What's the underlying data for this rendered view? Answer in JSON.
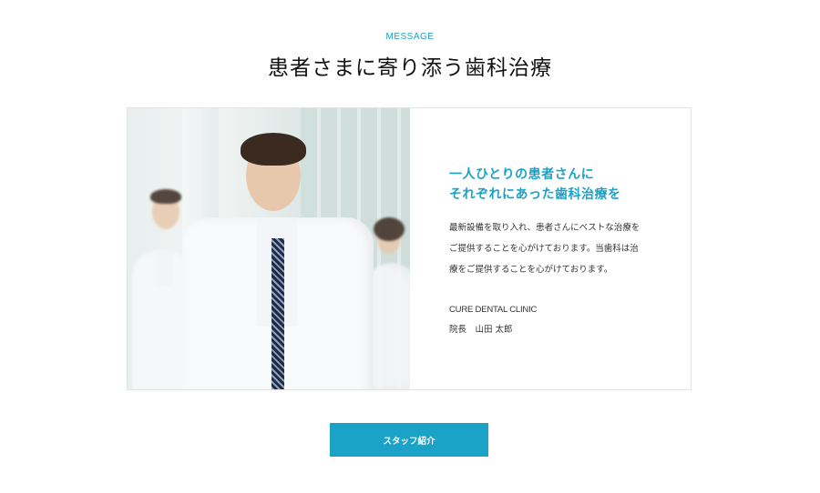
{
  "section": {
    "eyebrow": "MESSAGE",
    "title": "患者さまに寄り添う歯科治療"
  },
  "message": {
    "headline_lines": [
      "一人ひとりの患者さんに",
      "それぞれにあった歯科治療を"
    ],
    "body_lines": [
      "最新設備を取り入れ、患者さんにベストな治療を",
      "ご提供することを心がけております。当歯科は治",
      "療をご提供することを心がけております。"
    ],
    "clinic_name": "CURE DENTAL CLINIC",
    "director": "院長　山田 太郎"
  },
  "photo": {
    "subject": "doctors-in-white-coats"
  },
  "button": {
    "label": "スタッフ紹介"
  },
  "colors": {
    "accent": "#1aa2c7",
    "title": "#111111",
    "border": "#e3e3e3"
  }
}
